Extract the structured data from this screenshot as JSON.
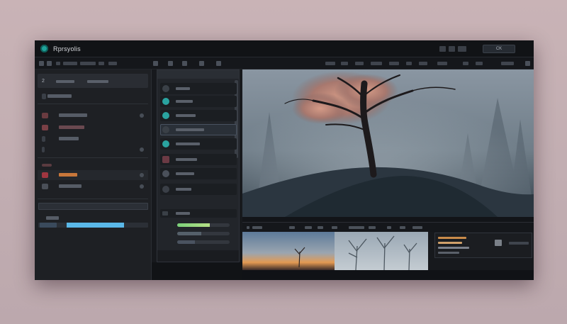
{
  "app": {
    "title": "Rprsyolis",
    "title_button": "CK"
  },
  "colors": {
    "accent": "#1fa39a",
    "progress": "#5ab8e8",
    "slider": "#7bd07a",
    "bar_red": "#6a3b40"
  },
  "icons": {
    "app_logo": "app-logo-icon",
    "left_tab": "panel-icon"
  },
  "left_panel": {
    "tab_number": "2",
    "progress": 0.52
  },
  "middle_panel": {
    "slider_level": 0.62
  }
}
